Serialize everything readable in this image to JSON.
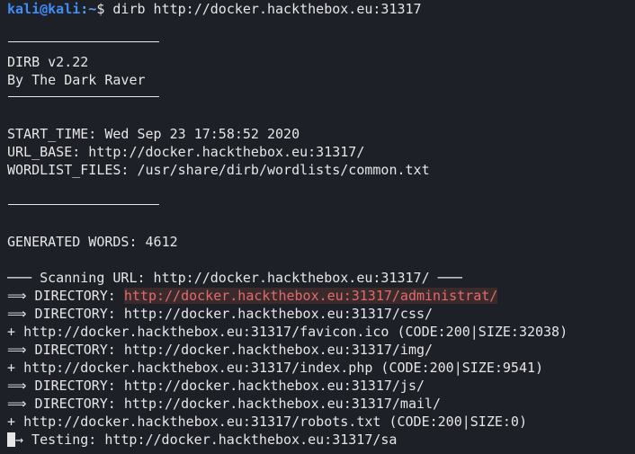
{
  "prompt": {
    "user_host": "kali@kali",
    "path": ":~",
    "symbol": "$ ",
    "command": "dirb http://docker.hackthebox.eu:31317"
  },
  "banner": {
    "title": "DIRB v2.22",
    "author": "By The Dark Raver"
  },
  "info": {
    "start_time": "START_TIME: Wed Sep 23 17:58:52 2020",
    "url_base": "URL_BASE: http://docker.hackthebox.eu:31317/",
    "wordlist": "WORDLIST_FILES: /usr/share/dirb/wordlists/common.txt"
  },
  "generated": "GENERATED WORDS: 4612",
  "scanning": "─── Scanning URL: http://docker.hackthebox.eu:31317/ ───",
  "results": [
    {
      "prefix": "⟹ DIRECTORY: ",
      "url": "http://docker.hackthebox.eu:31317/administrat/",
      "highlight": true
    },
    {
      "prefix": "⟹ DIRECTORY: ",
      "url": "http://docker.hackthebox.eu:31317/css/",
      "highlight": false
    },
    {
      "prefix": "+ ",
      "url": "http://docker.hackthebox.eu:31317/favicon.ico (CODE:200|SIZE:32038)",
      "highlight": false
    },
    {
      "prefix": "⟹ DIRECTORY: ",
      "url": "http://docker.hackthebox.eu:31317/img/",
      "highlight": false
    },
    {
      "prefix": "+ ",
      "url": "http://docker.hackthebox.eu:31317/index.php (CODE:200|SIZE:9541)",
      "highlight": false
    },
    {
      "prefix": "⟹ DIRECTORY: ",
      "url": "http://docker.hackthebox.eu:31317/js/",
      "highlight": false
    },
    {
      "prefix": "⟹ DIRECTORY: ",
      "url": "http://docker.hackthebox.eu:31317/mail/",
      "highlight": false
    },
    {
      "prefix": "+ ",
      "url": "http://docker.hackthebox.eu:31317/robots.txt (CODE:200|SIZE:0)",
      "highlight": false
    }
  ],
  "testing": "→ Testing: http://docker.hackthebox.eu:31317/sa"
}
